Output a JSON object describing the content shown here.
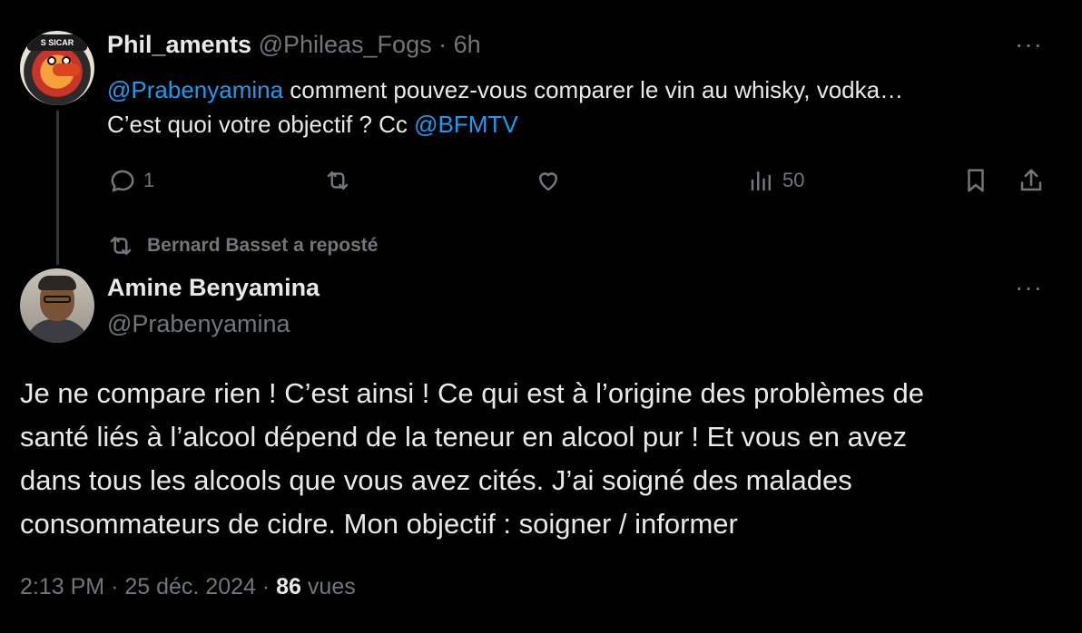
{
  "reply_tweet": {
    "display_name": "Phil_aments",
    "handle": "@Phileas_Fogs",
    "separator": "·",
    "time": "6h",
    "avatar_text": "S SICAR",
    "text_mention1": "@Prabenyamina",
    "text_part1": " comment pouvez-vous comparer le vin au whisky, vodka…",
    "text_part2": "C’est quoi votre objectif ? Cc ",
    "text_mention2": "@BFMTV",
    "actions": {
      "reply_count": "1",
      "views_count": "50"
    }
  },
  "repost_context": {
    "label": "Bernard Basset a reposté"
  },
  "main_tweet": {
    "display_name": "Amine Benyamina",
    "handle": "@Prabenyamina",
    "text_line1": "Je ne compare rien ! C’est ainsi ! Ce  qui est à l’origine des problèmes de",
    "text_line2": "santé liés à l’alcool dépend de la teneur en alcool pur ! Et vous en avez",
    "text_line3": "dans tous les alcools que vous avez cités. J’ai soigné des malades",
    "text_line4": "consommateurs de cidre. Mon objectif : soigner / informer",
    "time": "2:13 PM",
    "separator": "·",
    "date": "25 déc. 2024",
    "views_count": "86",
    "views_label": "vues"
  },
  "more_label": "···",
  "colors": {
    "background": "#000000",
    "text": "#e7e9ea",
    "muted": "#71767b",
    "link": "#1d9bf0",
    "thread_line": "#333639"
  },
  "icons": [
    "reply-icon",
    "retweet-icon",
    "like-icon",
    "views-icon",
    "bookmark-icon",
    "share-icon",
    "more-icon"
  ]
}
